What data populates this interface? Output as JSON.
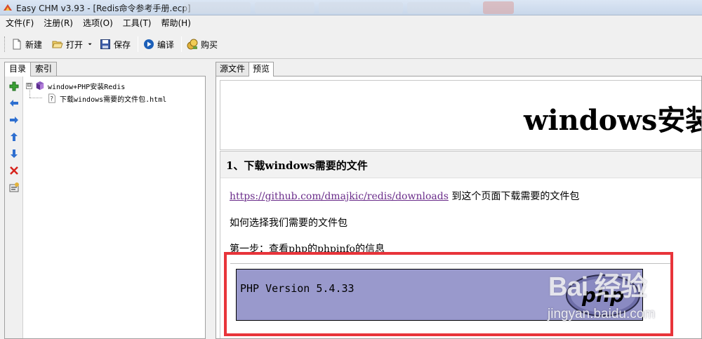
{
  "window": {
    "title": "Easy CHM v3.93 - [Redis命令参考手册.ecp]"
  },
  "menu": {
    "items": [
      "文件(F)",
      "注册(R)",
      "选项(O)",
      "工具(T)",
      "帮助(H)"
    ]
  },
  "toolbar": {
    "new_label": "新建",
    "open_label": "打开",
    "save_label": "保存",
    "compile_label": "编译",
    "buy_label": "购买"
  },
  "left_panel": {
    "tabs": [
      "目录",
      "索引"
    ],
    "active_tab": 0,
    "side_tools": [
      "add-icon",
      "arrow-left-icon",
      "arrow-right-icon",
      "arrow-up-icon",
      "arrow-down-icon",
      "delete-icon",
      "properties-icon"
    ],
    "tree": {
      "root": {
        "expander": "⊟",
        "label": "window+PHP安装Redis",
        "icon": "book-icon"
      },
      "children": [
        {
          "label": "下载windows需要的文件包.html",
          "icon": "help-page-icon"
        }
      ]
    }
  },
  "right_panel": {
    "tabs": [
      "源文件",
      "预览"
    ],
    "active_tab": 1,
    "doc": {
      "title": "windows安装",
      "section_title": "1、下载windows需要的文件",
      "link_text": "https://github.com/dmajkic/redis/downloads",
      "link_suffix": " 到这个页面下载需要的文件包",
      "para2": "如何选择我们需要的文件包",
      "para3": "第一步：查看php的phpinfo的信息",
      "php_version": "PHP Version 5.4.33",
      "php_logo_text": "php"
    }
  },
  "watermark": {
    "text": "Bai 经验",
    "url": "jingyan.baidu.com"
  },
  "colors": {
    "highlight_border": "#e8343a",
    "phpinfo_bg": "#9999cc",
    "link": "#6a2c8a"
  }
}
